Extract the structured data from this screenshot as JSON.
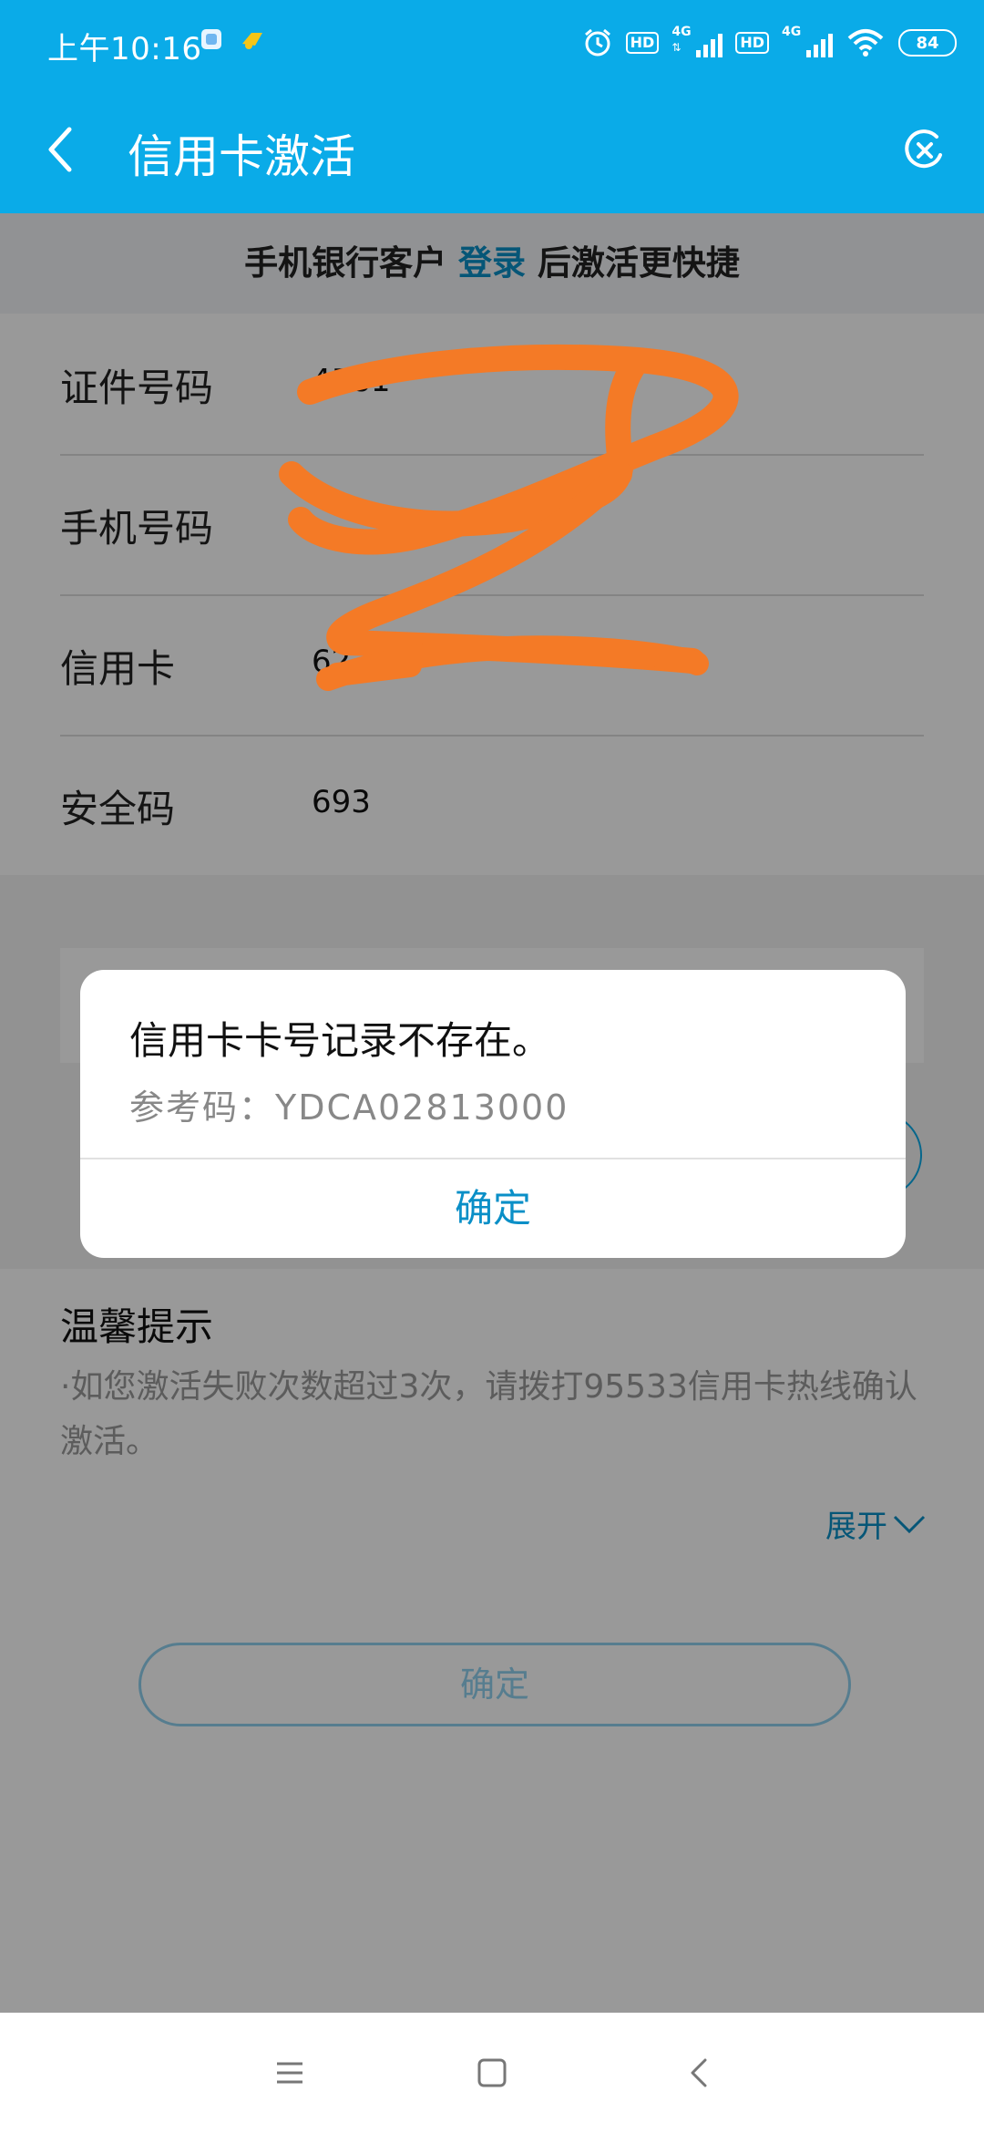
{
  "status_bar": {
    "time": "上午10:16",
    "hd1": "HD",
    "net1": "4G",
    "hd2": "HD",
    "net2": "4G",
    "battery": "84"
  },
  "header": {
    "title": "信用卡激活",
    "back_icon": "chevron-left-icon",
    "close_icon": "close-circle-icon"
  },
  "login_banner": {
    "prefix": "手机银行客户",
    "link": "登录",
    "suffix": "后激活更快捷"
  },
  "form": {
    "rows": [
      {
        "label": "证件号码",
        "value": "4581"
      },
      {
        "label": "手机号码",
        "value": ""
      },
      {
        "label": "信用卡",
        "value": "6227"
      },
      {
        "label": "安全码",
        "value": "693"
      }
    ]
  },
  "tips": {
    "heading": "温馨提示",
    "text": "·如您激活失败次数超过3次，请拨打95533信用卡热线确认激活。",
    "expand": "展开",
    "confirm": "确定"
  },
  "dialog": {
    "message": "信用卡卡号记录不存在。",
    "reference": "参考码：YDCA02813000",
    "ok": "确定"
  },
  "colors": {
    "brand": "#0aabe8",
    "link": "#0a8fc7",
    "scribble": "#f47a26"
  }
}
